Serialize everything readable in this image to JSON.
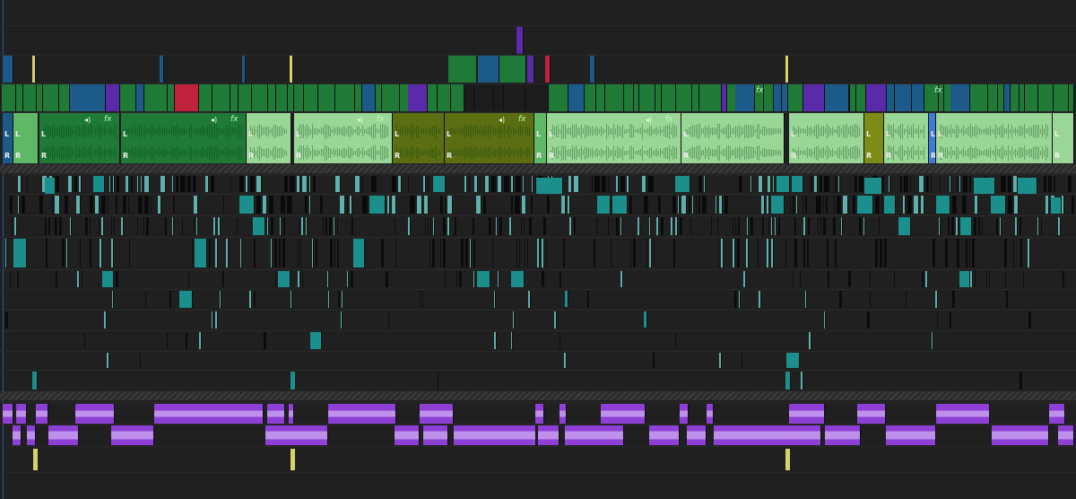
{
  "app": {
    "view": "sequence-timeline"
  },
  "colors": {
    "background": "#202020",
    "video_green": "#1f7a38",
    "video_blue": "#1c5a8a",
    "video_purple": "#5a2aa8",
    "audio_green": "#5fb865",
    "audio_light": "#9ad696",
    "audio_olive": "#5b6e12",
    "audio_teal": "#1a8f8c",
    "music_purple": "#8d3fd6",
    "marker_yellow": "#d6d36a",
    "accent_red": "#c0223b"
  },
  "channel_labels": {
    "left": "L",
    "right": "R"
  },
  "clip_badges": {
    "effect": "fx"
  }
}
